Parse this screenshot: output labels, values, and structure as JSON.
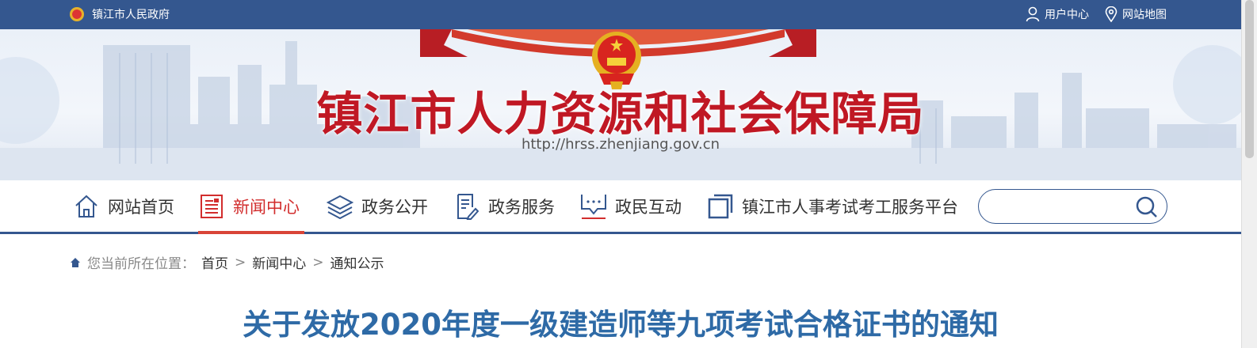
{
  "topbar": {
    "gov_label": "镇江市人民政府",
    "user_center": "用户中心",
    "sitemap": "网站地图"
  },
  "banner": {
    "title": "镇江市人力资源和社会保障局",
    "url": "http://hrss.zhenjiang.gov.cn"
  },
  "nav": {
    "items": [
      {
        "label": "网站首页",
        "icon": "home-icon"
      },
      {
        "label": "新闻中心",
        "icon": "newspaper-icon",
        "active": true
      },
      {
        "label": "政务公开",
        "icon": "layers-icon"
      },
      {
        "label": "政务服务",
        "icon": "document-edit-icon"
      },
      {
        "label": "政民互动",
        "icon": "chat-icon"
      },
      {
        "label": "镇江市人事考试考工服务平台",
        "icon": "window-icon"
      }
    ]
  },
  "search": {
    "placeholder": ""
  },
  "breadcrumb": {
    "prefix": "您当前所在位置：",
    "items": [
      "首页",
      "新闻中心",
      "通知公示"
    ],
    "separator": ">"
  },
  "article": {
    "title": "关于发放2020年度一级建造师等九项考试合格证书的通知"
  },
  "colors": {
    "brand_blue": "#34578f",
    "accent_red": "#c01824",
    "title_blue": "#2e6aa6"
  }
}
